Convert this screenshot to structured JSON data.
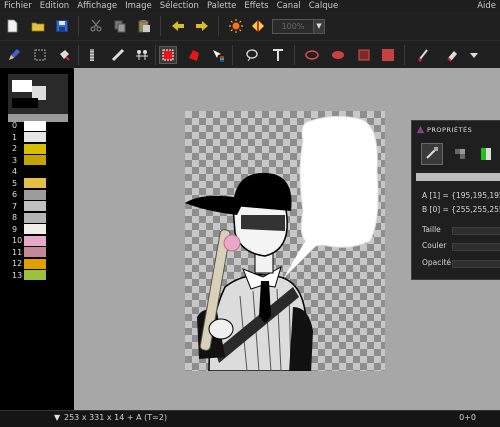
{
  "menu": [
    {
      "label": "Fichier"
    },
    {
      "label": "Edition"
    },
    {
      "label": "Affichage"
    },
    {
      "label": "Image"
    },
    {
      "label": "Sélection"
    },
    {
      "label": "Palette"
    },
    {
      "label": "Effets"
    },
    {
      "label": "Canal"
    },
    {
      "label": "Calque"
    }
  ],
  "help_label": "Aide",
  "zoom": {
    "value": "100%",
    "arrow": "▼"
  },
  "palette": [
    {
      "index": "0",
      "color": "#ffffff"
    },
    {
      "index": "1",
      "color": "#e6e6e6"
    },
    {
      "index": "2",
      "color": "#d4c000"
    },
    {
      "index": "3",
      "color": "#c4a400"
    },
    {
      "index": "4",
      "color": "#000000"
    },
    {
      "index": "5",
      "color": "#e6c040"
    },
    {
      "index": "6",
      "color": "#9c9c9c"
    },
    {
      "index": "7",
      "color": "#c0c0c0"
    },
    {
      "index": "8",
      "color": "#b4b4b4"
    },
    {
      "index": "9",
      "color": "#f2f0e6"
    },
    {
      "index": "10",
      "color": "#e8a8c8"
    },
    {
      "index": "11",
      "color": "#c08898"
    },
    {
      "index": "12",
      "color": "#e0a000"
    },
    {
      "index": "13",
      "color": "#9cc040"
    }
  ],
  "properties": {
    "title": "PROPRIÉTÉS",
    "color_a": "A [1] = {195,195,195}",
    "color_b": "B [0] = {255,255,255}",
    "size_label": "Taille",
    "color_label": "Couler",
    "opacity_label": "Opacité"
  },
  "status": {
    "left": "253 x 331 x 14 + A  (T=2)",
    "right": "0+0",
    "scroll_icon": "▼"
  },
  "colors": {
    "ui_bg": "#202020",
    "canvas_bg": "#a7a7a7",
    "accent_red": "#e01818"
  }
}
